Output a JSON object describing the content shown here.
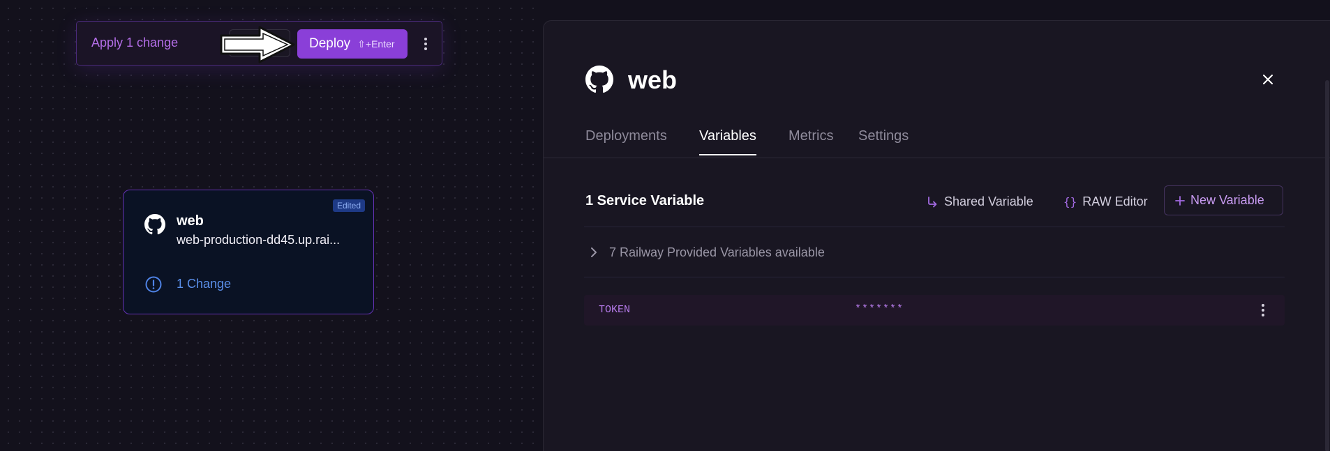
{
  "change_bar": {
    "apply_label": "Apply 1 change",
    "details_label": "Details",
    "deploy_label": "Deploy",
    "deploy_shortcut": "⇧+Enter",
    "more_icon": "more-vertical-icon"
  },
  "service_card": {
    "badge": "Edited",
    "title": "web",
    "url": "web-production-dd45.up.rai...",
    "change_label": "1 Change",
    "icon": "github-icon"
  },
  "panel": {
    "title": "web",
    "tabs": [
      {
        "label": "Deployments",
        "active": false
      },
      {
        "label": "Variables",
        "active": true
      },
      {
        "label": "Metrics",
        "active": false
      },
      {
        "label": "Settings",
        "active": false
      }
    ],
    "variables_title": "1 Service Variable",
    "actions": {
      "shared": "Shared Variable",
      "raw": "RAW Editor",
      "new": "New Variable"
    },
    "provided_label": "7 Railway Provided Variables available",
    "variables": [
      {
        "name": "TOKEN",
        "value": "*******"
      }
    ]
  },
  "colors": {
    "accent": "#8a3fd8",
    "accent_text": "#b46ee8",
    "link_blue": "#5a8ee8",
    "panel_bg": "#191622",
    "canvas_bg": "#13111c"
  }
}
